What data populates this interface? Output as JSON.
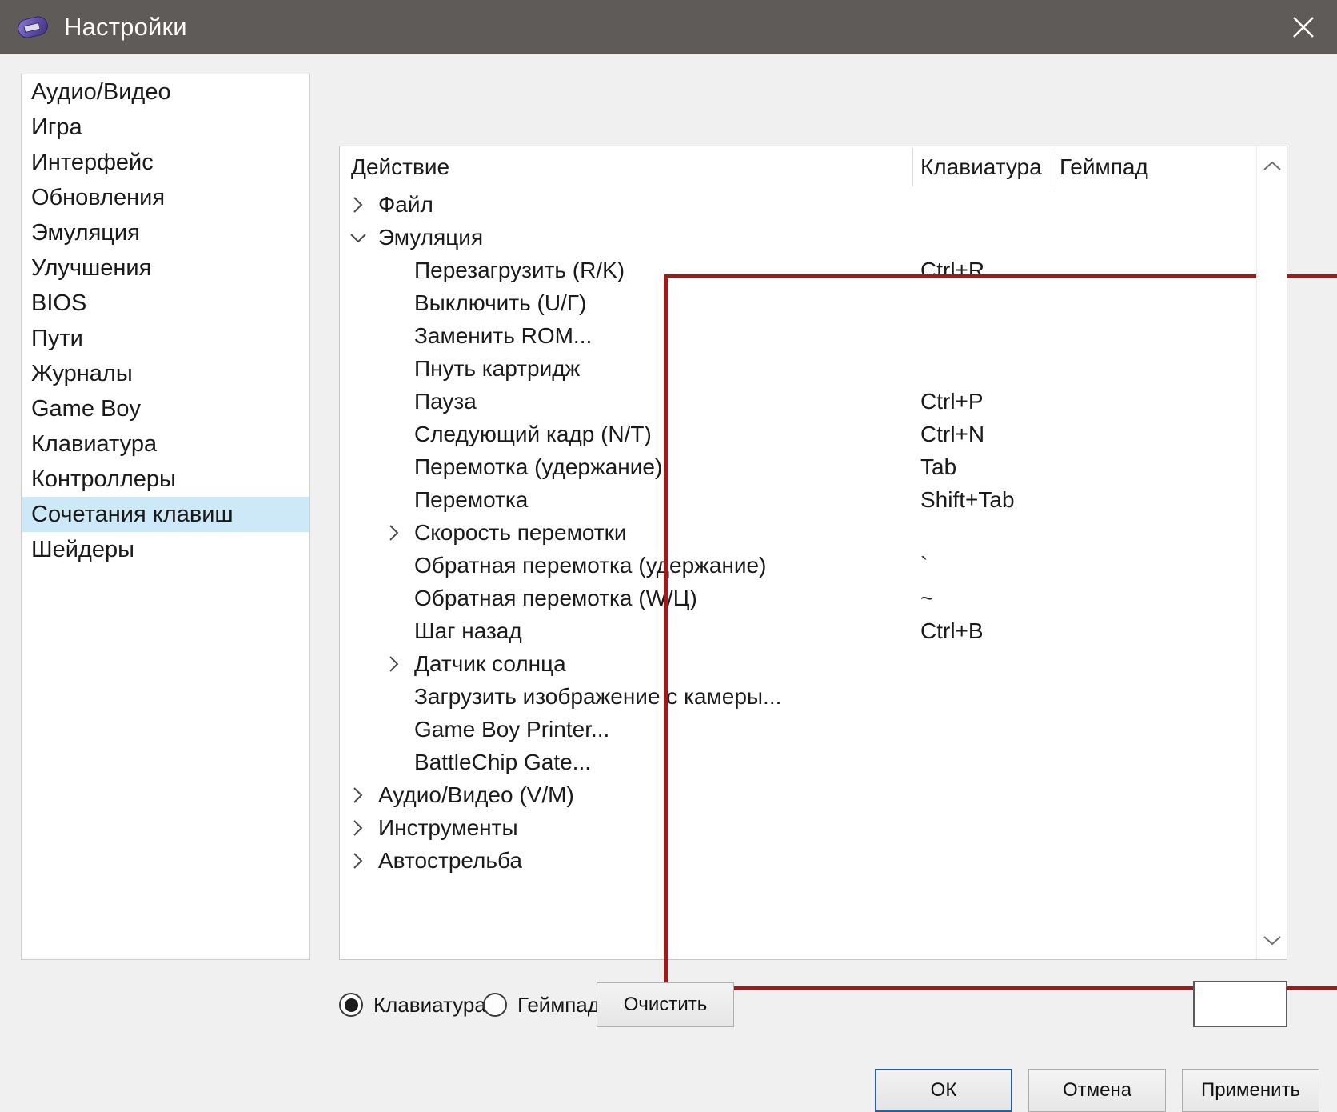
{
  "window": {
    "title": "Настройки",
    "close_icon": "close-icon",
    "app_icon": "cartridge-icon"
  },
  "sidebar": {
    "items": [
      {
        "label": "Аудио/Видео",
        "selected": false
      },
      {
        "label": "Игра",
        "selected": false
      },
      {
        "label": "Интерфейс",
        "selected": false
      },
      {
        "label": "Обновления",
        "selected": false
      },
      {
        "label": "Эмуляция",
        "selected": false
      },
      {
        "label": "Улучшения",
        "selected": false
      },
      {
        "label": "BIOS",
        "selected": false
      },
      {
        "label": "Пути",
        "selected": false
      },
      {
        "label": "Журналы",
        "selected": false
      },
      {
        "label": "Game Boy",
        "selected": false
      },
      {
        "label": "Клавиатура",
        "selected": false
      },
      {
        "label": "Контроллеры",
        "selected": false
      },
      {
        "label": "Сочетания клавиш",
        "selected": true
      },
      {
        "label": "Шейдеры",
        "selected": false
      }
    ]
  },
  "table": {
    "columns": {
      "action": "Действие",
      "keyboard": "Клавиатура",
      "gamepad": "Геймпад"
    },
    "rows": [
      {
        "depth": 1,
        "arrow": "collapsed",
        "label": "Файл",
        "key": ""
      },
      {
        "depth": 1,
        "arrow": "expanded",
        "label": "Эмуляция",
        "key": ""
      },
      {
        "depth": 2,
        "arrow": "none",
        "label": "Перезагрузить (R/K)",
        "key": "Ctrl+R"
      },
      {
        "depth": 2,
        "arrow": "none",
        "label": "Выключить (U/Г)",
        "key": ""
      },
      {
        "depth": 2,
        "arrow": "none",
        "label": "Заменить ROM...",
        "key": ""
      },
      {
        "depth": 2,
        "arrow": "none",
        "label": "Пнуть картридж",
        "key": ""
      },
      {
        "depth": 2,
        "arrow": "none",
        "label": "Пауза",
        "key": "Ctrl+P"
      },
      {
        "depth": 2,
        "arrow": "none",
        "label": "Следующий кадр (N/Т)",
        "key": "Ctrl+N"
      },
      {
        "depth": 2,
        "arrow": "none",
        "label": "Перемотка (удержание)",
        "key": "Tab"
      },
      {
        "depth": 2,
        "arrow": "none",
        "label": "Перемотка",
        "key": "Shift+Tab"
      },
      {
        "depth": 2,
        "arrow": "collapsed",
        "label": "Скорость перемотки",
        "key": ""
      },
      {
        "depth": 2,
        "arrow": "none",
        "label": "Обратная перемотка (удержание)",
        "key": "`"
      },
      {
        "depth": 2,
        "arrow": "none",
        "label": "Обратная перемотка (W/Ц)",
        "key": "~"
      },
      {
        "depth": 2,
        "arrow": "none",
        "label": "Шаг назад",
        "key": "Ctrl+B"
      },
      {
        "depth": 2,
        "arrow": "collapsed",
        "label": "Датчик солнца",
        "key": ""
      },
      {
        "depth": 2,
        "arrow": "none",
        "label": "Загрузить изображение с камеры...",
        "key": ""
      },
      {
        "depth": 2,
        "arrow": "none",
        "label": "Game Boy Printer...",
        "key": ""
      },
      {
        "depth": 2,
        "arrow": "none",
        "label": "BattleChip Gate...",
        "key": ""
      },
      {
        "depth": 1,
        "arrow": "collapsed",
        "label": "Аудио/Видео (V/M)",
        "key": ""
      },
      {
        "depth": 1,
        "arrow": "collapsed",
        "label": "Инструменты",
        "key": ""
      },
      {
        "depth": 1,
        "arrow": "collapsed",
        "label": "Автострельба",
        "key": ""
      }
    ]
  },
  "scrollbar": {
    "up_icon": "chevron-up-icon",
    "down_icon": "chevron-down-icon"
  },
  "controls": {
    "radio_keyboard": "Клавиатура",
    "radio_gamepad": "Геймпад",
    "keyboard_selected": true,
    "gamepad_selected": false,
    "clear_label": "Очистить",
    "binding_value": "",
    "binding_placeholder": ""
  },
  "dialog": {
    "ok": "ОК",
    "cancel": "Отмена",
    "apply": "Применить"
  },
  "colors": {
    "titlebar": "#5e5b58",
    "selection": "#cde8f7",
    "annotation_red": "#9e1b1b",
    "primary_border": "#2b5d9e"
  }
}
